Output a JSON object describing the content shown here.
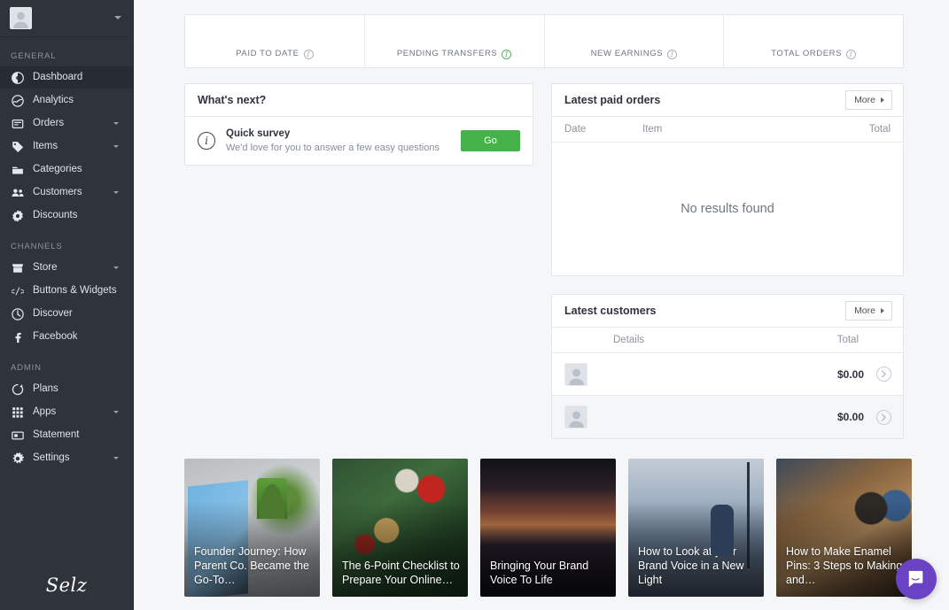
{
  "sidebar": {
    "account": {
      "avatar_alt": "user-avatar-placeholder",
      "username": ""
    },
    "sections": [
      {
        "label": "GENERAL",
        "items": [
          {
            "label": "Dashboard",
            "icon": "dashboard-icon",
            "active": true,
            "expandable": false
          },
          {
            "label": "Analytics",
            "icon": "analytics-icon",
            "active": false,
            "expandable": false
          },
          {
            "label": "Orders",
            "icon": "orders-icon",
            "active": false,
            "expandable": true
          },
          {
            "label": "Items",
            "icon": "tag-icon",
            "active": false,
            "expandable": true
          },
          {
            "label": "Categories",
            "icon": "folder-icon",
            "active": false,
            "expandable": false
          },
          {
            "label": "Customers",
            "icon": "customers-icon",
            "active": false,
            "expandable": true
          },
          {
            "label": "Discounts",
            "icon": "discount-icon",
            "active": false,
            "expandable": false
          }
        ]
      },
      {
        "label": "CHANNELS",
        "items": [
          {
            "label": "Store",
            "icon": "store-icon",
            "active": false,
            "expandable": true
          },
          {
            "label": "Buttons & Widgets",
            "icon": "code-icon",
            "active": false,
            "expandable": false
          },
          {
            "label": "Discover",
            "icon": "discover-icon",
            "active": false,
            "expandable": false
          },
          {
            "label": "Facebook",
            "icon": "facebook-icon",
            "active": false,
            "expandable": false
          }
        ]
      },
      {
        "label": "ADMIN",
        "items": [
          {
            "label": "Plans",
            "icon": "refresh-icon",
            "active": false,
            "expandable": false
          },
          {
            "label": "Apps",
            "icon": "grid-icon",
            "active": false,
            "expandable": true
          },
          {
            "label": "Statement",
            "icon": "statement-icon",
            "active": false,
            "expandable": false
          },
          {
            "label": "Settings",
            "icon": "gear-icon",
            "active": false,
            "expandable": true
          }
        ]
      }
    ],
    "brand": "Selz"
  },
  "stats": [
    {
      "label": "PAID TO DATE",
      "value": "",
      "info_icon": "info-icon",
      "info_color": "#aab2bd"
    },
    {
      "label": "PENDING TRANSFERS",
      "value": "",
      "info_icon": "info-icon",
      "info_color": "#52b85a"
    },
    {
      "label": "NEW EARNINGS",
      "value": "",
      "info_icon": "info-icon",
      "info_color": "#aab2bd"
    },
    {
      "label": "TOTAL ORDERS",
      "value": "",
      "info_icon": "info-icon",
      "info_color": "#aab2bd"
    }
  ],
  "whats_next": {
    "title": "What's next?",
    "item": {
      "icon": "info-circle-icon",
      "title": "Quick survey",
      "subtitle": "We'd love for you to answer a few easy questions",
      "button": "Go",
      "button_color": "#46b34a"
    }
  },
  "latest_paid_orders": {
    "title": "Latest paid orders",
    "more_label": "More",
    "columns": [
      "Date",
      "Item",
      "Total"
    ],
    "empty_text": "No results found",
    "rows": []
  },
  "latest_customers": {
    "title": "Latest customers",
    "more_label": "More",
    "columns": [
      "Details",
      "Total"
    ],
    "rows": [
      {
        "avatar": "customer-avatar-placeholder",
        "name": "",
        "total": "$0.00",
        "action_icon": "chevron-right-icon"
      },
      {
        "avatar": "customer-avatar-placeholder",
        "name": "",
        "total": "$0.00",
        "action_icon": "chevron-right-icon"
      }
    ]
  },
  "blog_posts": [
    {
      "title": "Founder Journey: How Parent Co. Became the Go-To…",
      "image": "laptop-with-parent-co-website-and-plant"
    },
    {
      "title": "The 6-Point Checklist to Prepare Your Online…",
      "image": "christmas-tree-ornaments"
    },
    {
      "title": "Bringing Your Brand Voice To Life",
      "image": "hands-holding-sparkling-lights-at-dusk"
    },
    {
      "title": "How to Look at your Brand Voice in a New Light",
      "image": "person-climbing-tower-above-clouds"
    },
    {
      "title": "How to Make Enamel Pins: 3 Steps to Making and…",
      "image": "desk-with-sketchbook-coffee-and-pens"
    }
  ],
  "chat_widget": {
    "icon": "chat-bubble-icon",
    "color": "#6a43c4"
  }
}
